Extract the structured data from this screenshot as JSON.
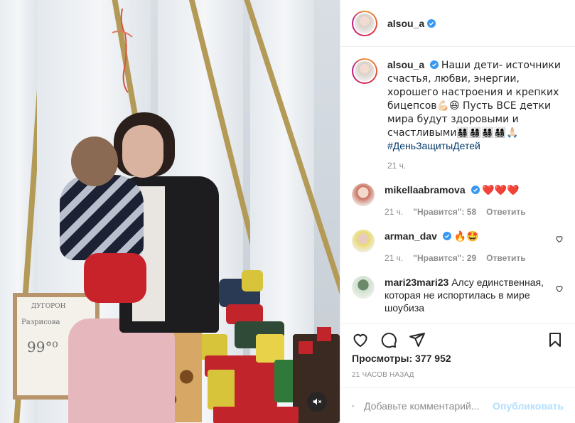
{
  "post": {
    "author": "alsou_a",
    "caption": {
      "text": "Наши дети- источники счастья, любви, энергии, хорошего настроения и крепких бицепсов💪🏻😆 Пусть ВСЕ детки мира будут здоровыми и счастливыми👨‍👩‍👧‍👦👨‍👩‍👧‍👦👨‍👩‍👧‍👦👨‍👩‍👧‍👦🙏🏻",
      "hashtag": "#ДеньЗащитыДетей",
      "time": "21 ч."
    },
    "comments": [
      {
        "user": "mikellaabramova",
        "verified": true,
        "text": "❤️❤️❤️",
        "time": "21 ч.",
        "likes": "\"Нравится\": 58",
        "reply": "Ответить"
      },
      {
        "user": "arman_dav",
        "verified": true,
        "text": "🔥🤩",
        "time": "21 ч.",
        "likes": "\"Нравится\": 29",
        "reply": "Ответить"
      },
      {
        "user": "mari23mari23",
        "verified": false,
        "text": "Алсу единственная, которая не испортилась в мире шоубиза"
      }
    ],
    "views": "Просмотры: 377 952",
    "posted_ago": "21 часов назад",
    "add_comment": {
      "placeholder": "Добавьте комментарий...",
      "submit": "Опубликовать"
    }
  },
  "media": {
    "whiteboard_text": [
      "ДУГОРОН",
      "Разрисова",
      "99°⁰"
    ]
  },
  "colors": {
    "verified_blue": "#3897f0",
    "link_blue": "#00376b",
    "post_disabled": "#b2dffc"
  }
}
